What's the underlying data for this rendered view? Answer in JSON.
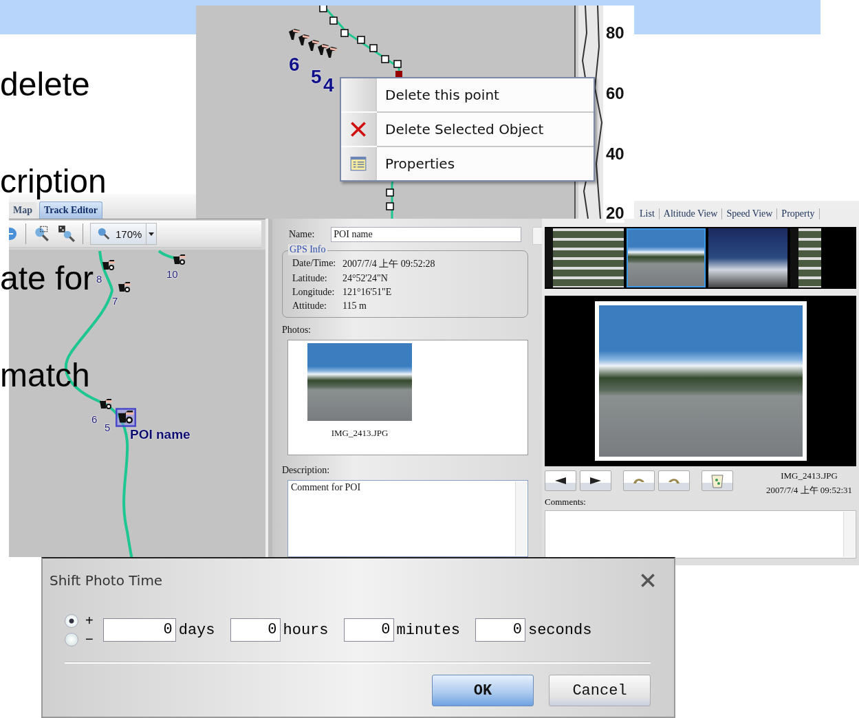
{
  "slide": {
    "bullets": [
      {
        "text": "delete"
      },
      {
        "text": "cription"
      },
      {
        "text": "ate for"
      },
      {
        "text": "match"
      }
    ]
  },
  "map_window": {
    "tabs": [
      {
        "label": "Map",
        "selected": false
      },
      {
        "label": "Track Editor",
        "selected": true
      }
    ],
    "zoom": "170%",
    "markers": [
      {
        "label": "8"
      },
      {
        "label": "7"
      },
      {
        "label": "10"
      },
      {
        "label": "6"
      },
      {
        "label": "5",
        "selected": true
      }
    ],
    "poi_label": "POI name"
  },
  "context_window": {
    "track_numbers": [
      "6",
      "5",
      "4"
    ],
    "axis_labels": [
      "80",
      "60",
      "40",
      "20"
    ],
    "menu": [
      {
        "label": "Delete this point",
        "kind": "plain"
      },
      {
        "label": "Delete Selected Object",
        "kind": "delete"
      },
      {
        "label": "Properties",
        "kind": "properties"
      }
    ]
  },
  "properties_panel": {
    "name_label": "Name:",
    "name_value": "POI name",
    "gps_title": "GPS Info",
    "gps_rows": [
      {
        "label": "Date/Time:",
        "value": "2007/7/4 上午 09:52:28"
      },
      {
        "label": "Latitude:",
        "value": "24°52'24\"N"
      },
      {
        "label": "Longitude:",
        "value": "121°16'51\"E"
      },
      {
        "label": "Attitude:",
        "value": "115 m"
      }
    ],
    "photos_label": "Photos:",
    "photo_caption": "IMG_2413.JPG",
    "description_label": "Description:",
    "description_value": "Comment for POI"
  },
  "viewer": {
    "tabs": [
      {
        "label": "List",
        "selected": false
      },
      {
        "label": "Altitude View",
        "selected": false
      },
      {
        "label": "Speed View",
        "selected": false
      },
      {
        "label": "Property",
        "selected": false
      }
    ],
    "thumbnails": [
      {
        "selected": false
      },
      {
        "selected": true
      },
      {
        "selected": false
      },
      {
        "selected": false
      }
    ],
    "file_name": "IMG_2413.JPG",
    "date_time": "2007/7/4 上午 09:52:31",
    "comments_label": "Comments:"
  },
  "dialog": {
    "title": "Shift Photo Time",
    "signs": [
      {
        "label": "+",
        "selected": true
      },
      {
        "label": "−",
        "selected": false
      }
    ],
    "fields": [
      {
        "value": "0",
        "unit": "days"
      },
      {
        "value": "0",
        "unit": "hours"
      },
      {
        "value": "0",
        "unit": "minutes"
      },
      {
        "value": "0",
        "unit": "seconds"
      }
    ],
    "buttons": [
      {
        "label": "OK",
        "kind": "primary"
      },
      {
        "label": "Cancel",
        "kind": "secondary"
      }
    ]
  }
}
